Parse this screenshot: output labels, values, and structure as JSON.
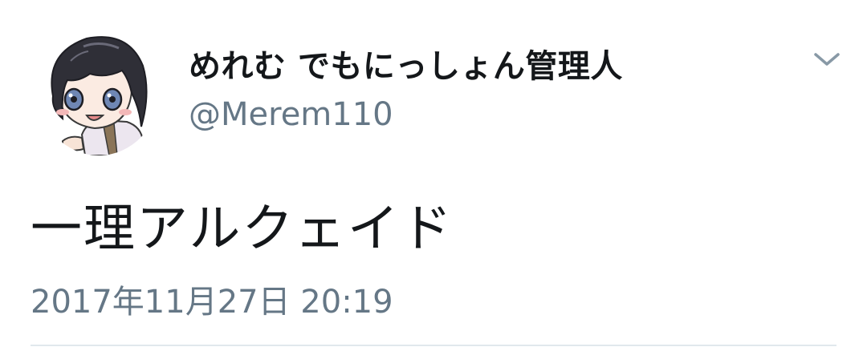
{
  "tweet": {
    "display_name": "めれむ でもにっしょん管理人",
    "handle": "@Merem110",
    "text": "一理アルクェイド",
    "timestamp": "2017年11月27日 20:19"
  },
  "icons": {
    "avatar": "anime-character-avatar",
    "menu": "chevron-down-icon"
  },
  "colors": {
    "name": "#14171a",
    "secondary": "#657786",
    "divider": "#e1e8ed"
  }
}
